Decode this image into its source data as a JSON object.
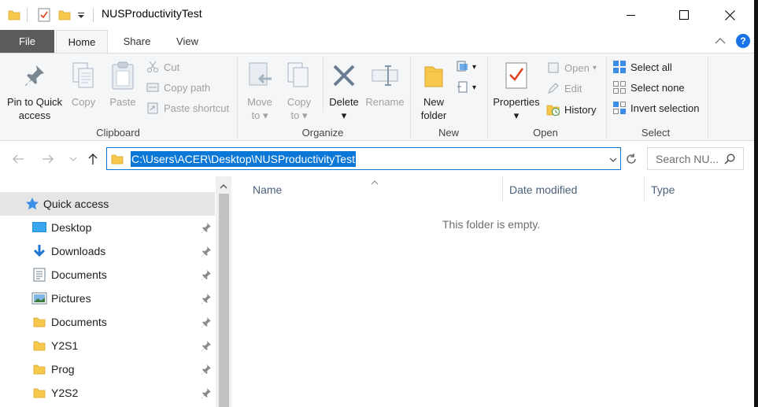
{
  "window": {
    "title": "NUSProductivityTest"
  },
  "tabs": {
    "file": "File",
    "home": "Home",
    "share": "Share",
    "view": "View"
  },
  "ribbon": {
    "clipboard": {
      "pin_quick_access_line1": "Pin to Quick",
      "pin_quick_access_line2": "access",
      "copy": "Copy",
      "paste": "Paste",
      "cut": "Cut",
      "copy_path": "Copy path",
      "paste_shortcut": "Paste shortcut",
      "group": "Clipboard"
    },
    "organize": {
      "move_to_line1": "Move",
      "move_to_line2": "to",
      "copy_to_line1": "Copy",
      "copy_to_line2": "to",
      "delete": "Delete",
      "rename": "Rename",
      "group": "Organize"
    },
    "new": {
      "new_folder_line1": "New",
      "new_folder_line2": "folder",
      "group": "New"
    },
    "open": {
      "properties": "Properties",
      "open": "Open",
      "edit": "Edit",
      "history": "History",
      "group": "Open"
    },
    "select": {
      "select_all": "Select all",
      "select_none": "Select none",
      "invert_selection": "Invert selection",
      "group": "Select"
    }
  },
  "address_bar": {
    "path": "C:\\Users\\ACER\\Desktop\\NUSProductivityTest",
    "search_placeholder": "Search NU..."
  },
  "nav_pane": {
    "items": [
      {
        "label": "Quick access",
        "icon": "star-icon"
      },
      {
        "label": "Desktop",
        "icon": "desktop-icon"
      },
      {
        "label": "Downloads",
        "icon": "download-icon"
      },
      {
        "label": "Documents",
        "icon": "documents-icon"
      },
      {
        "label": "Pictures",
        "icon": "pictures-icon"
      },
      {
        "label": "Documents",
        "icon": "folder-icon"
      },
      {
        "label": "Y2S1",
        "icon": "folder-icon"
      },
      {
        "label": "Prog",
        "icon": "folder-icon"
      },
      {
        "label": "Y2S2",
        "icon": "folder-icon"
      }
    ]
  },
  "content": {
    "columns": [
      "Name",
      "Date modified",
      "Type"
    ],
    "empty_message": "This folder is empty."
  },
  "colors": {
    "accent": "#0b78d7",
    "file_tab": "#5b5b5b",
    "folder": "#f8c84c"
  }
}
